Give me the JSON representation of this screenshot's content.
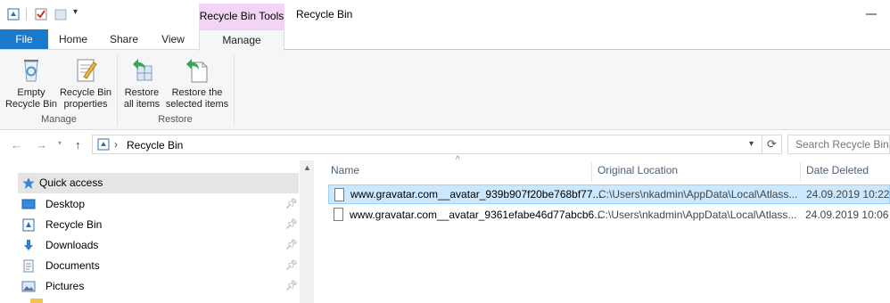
{
  "window": {
    "title": "Recycle Bin",
    "context_tab": "Recycle Bin Tools"
  },
  "ribbon_tabs": [
    {
      "label": "File"
    },
    {
      "label": "Home"
    },
    {
      "label": "Share"
    },
    {
      "label": "View"
    },
    {
      "label": "Manage"
    }
  ],
  "ribbon": {
    "empty_bin": {
      "line1": "Empty",
      "line2": "Recycle Bin"
    },
    "properties": {
      "line1": "Recycle Bin",
      "line2": "properties"
    },
    "restore_all": {
      "line1": "Restore",
      "line2": "all items"
    },
    "restore_selected": {
      "line1": "Restore the",
      "line2": "selected items"
    },
    "groups": {
      "manage": "Manage",
      "restore": "Restore"
    }
  },
  "address": {
    "path": "Recycle Bin",
    "separator": "›",
    "search_placeholder": "Search Recycle Bin"
  },
  "nav": {
    "quick_access": "Quick access",
    "items": [
      {
        "label": "Desktop",
        "icon": "desktop-icon",
        "pinned": true
      },
      {
        "label": "Recycle Bin",
        "icon": "recycle-bin-icon",
        "pinned": true
      },
      {
        "label": "Downloads",
        "icon": "downloads-icon",
        "pinned": true
      },
      {
        "label": "Documents",
        "icon": "documents-icon",
        "pinned": true
      },
      {
        "label": "Pictures",
        "icon": "pictures-icon",
        "pinned": true
      }
    ]
  },
  "columns": {
    "name": "Name",
    "location": "Original Location",
    "date": "Date Deleted"
  },
  "files": [
    {
      "name": "www.gravatar.com__avatar_939b907f20be768bf77...",
      "location": "C:\\Users\\nkadmin\\AppData\\Local\\Atlass...",
      "date": "24.09.2019 10:22",
      "selected": true
    },
    {
      "name": "www.gravatar.com__avatar_9361efabe46d77abcb6...",
      "location": "C:\\Users\\nkadmin\\AppData\\Local\\Atlass...",
      "date": "24.09.2019 10:06",
      "selected": false
    }
  ],
  "colors": {
    "file_tab": "#1979ca",
    "context_tab": "#f2d5f4",
    "selection": "#cce8ff"
  }
}
